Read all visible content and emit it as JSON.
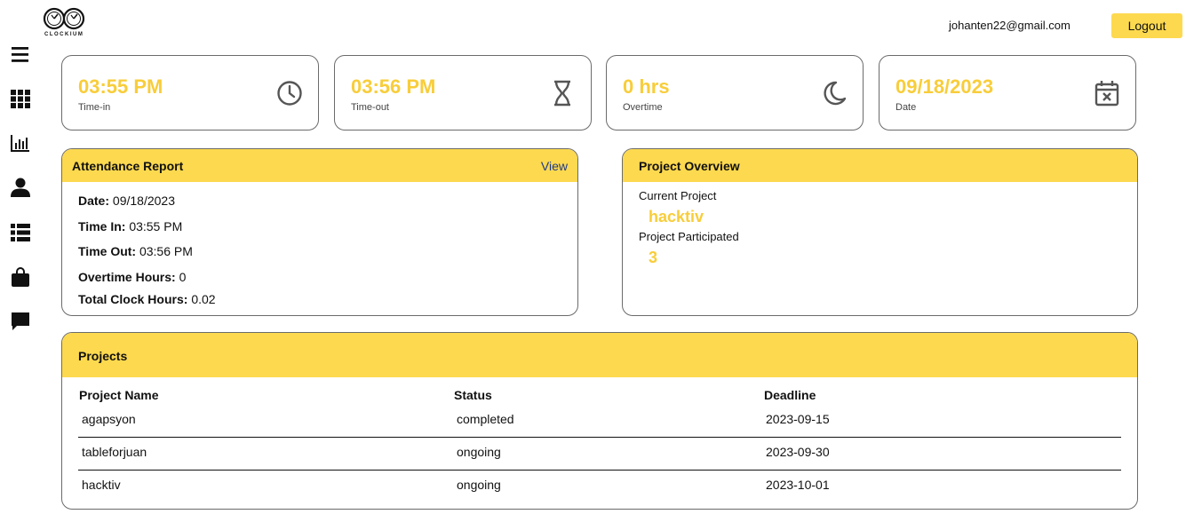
{
  "brand": {
    "logo_text": "CLOCKIUM"
  },
  "header": {
    "email": "johanten22@gmail.com",
    "logout_label": "Logout"
  },
  "colors": {
    "accent": "#fdd94f",
    "value": "#f8cd3a",
    "link": "#1f3a8a",
    "border": "#6b6b6b"
  },
  "sidebar": {
    "items": [
      {
        "icon": "menu-icon"
      },
      {
        "icon": "grid-icon"
      },
      {
        "icon": "bar-chart-icon"
      },
      {
        "icon": "user-icon"
      },
      {
        "icon": "list-icon"
      },
      {
        "icon": "shopping-bag-icon"
      },
      {
        "icon": "chat-icon"
      }
    ]
  },
  "cards": [
    {
      "value": "03:55 PM",
      "label": "Time-in",
      "icon": "clock-icon"
    },
    {
      "value": "03:56 PM",
      "label": "Time-out",
      "icon": "hourglass-icon"
    },
    {
      "value": "0 hrs",
      "label": "Overtime",
      "icon": "moon-icon"
    },
    {
      "value": "09/18/2023",
      "label": "Date",
      "icon": "calendar-x-icon"
    }
  ],
  "attendance": {
    "title": "Attendance Report",
    "view_label": "View",
    "rows": [
      {
        "label": "Date:",
        "value": "09/18/2023"
      },
      {
        "label": "Time In:",
        "value": "03:55 PM"
      },
      {
        "label": "Time Out:",
        "value": "03:56 PM"
      },
      {
        "label": "Overtime Hours:",
        "value": "0"
      },
      {
        "label": "Total Clock Hours:",
        "value": "0.02"
      }
    ]
  },
  "overview": {
    "title": "Project Overview",
    "current_label": "Current Project",
    "current_value": "hacktiv",
    "participated_label": "Project Participated",
    "participated_value": "3"
  },
  "projects": {
    "title": "Projects",
    "columns": [
      "Project Name",
      "Status",
      "Deadline"
    ],
    "rows": [
      [
        "agapsyon",
        "completed",
        "2023-09-15"
      ],
      [
        "tableforjuan",
        "ongoing",
        "2023-09-30"
      ],
      [
        "hacktiv",
        "ongoing",
        "2023-10-01"
      ]
    ]
  }
}
